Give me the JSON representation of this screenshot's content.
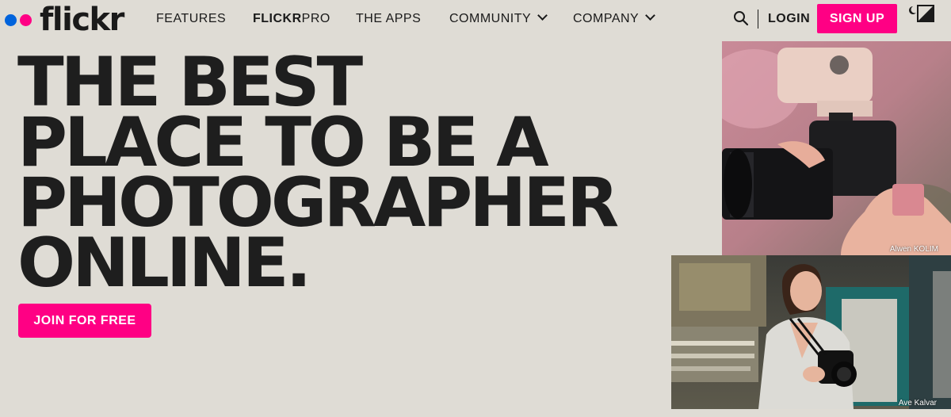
{
  "nav": {
    "logo_text": "flickr",
    "links": [
      {
        "label": "FEATURES"
      },
      {
        "label_bold": "FLICKR",
        "label_rest": "PRO"
      },
      {
        "label": "THE APPS"
      },
      {
        "label": "COMMUNITY"
      },
      {
        "label": "COMPANY"
      }
    ],
    "login_label": "LOGIN",
    "signup_label": "SIGN UP",
    "icons": [
      "search-icon",
      "theme-toggle-icon",
      "chevron-down-icon"
    ]
  },
  "hero": {
    "lines": [
      "THE BEST",
      "PLACE TO BE A",
      "PHOTOGRAPHER",
      "ONLINE."
    ],
    "cta_label": "JOIN FOR FREE"
  },
  "photos": [
    {
      "credit": "Alwen KOLIM"
    },
    {
      "credit": "Ave Kalvar"
    }
  ],
  "colors": {
    "background": "#dfdcd5",
    "brand_pink": "#ff0084",
    "brand_blue": "#0063dc",
    "text": "#1a1a1a"
  }
}
